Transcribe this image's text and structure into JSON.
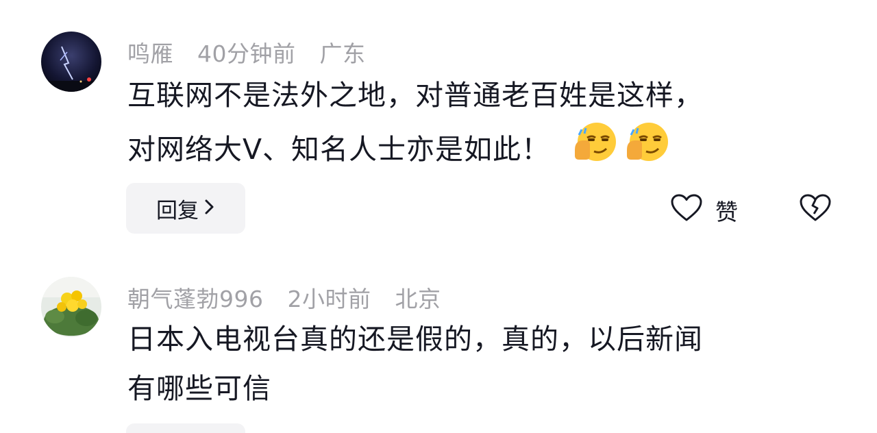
{
  "comments": [
    {
      "username": "鸣雁",
      "time": "40分钟前",
      "location": "广东",
      "text_line1": "互联网不是法外之地，对普通老百姓是这样，",
      "text_line2": "对网络大V、知名人士亦是如此！",
      "emoji": [
        "smirk-thumb-emoji",
        "smirk-thumb-emoji"
      ],
      "reply_label": "回复",
      "like_label": "赞"
    },
    {
      "username": "朝气蓬勃996",
      "time": "2小时前",
      "location": "北京",
      "text_line1": "日本入电视台真的还是假的，真的，以后新闻",
      "text_line2": "有哪些可信"
    }
  ],
  "colors": {
    "meta_gray": "#a1a1a6",
    "text": "#161823",
    "button_bg": "#f3f3f5"
  }
}
